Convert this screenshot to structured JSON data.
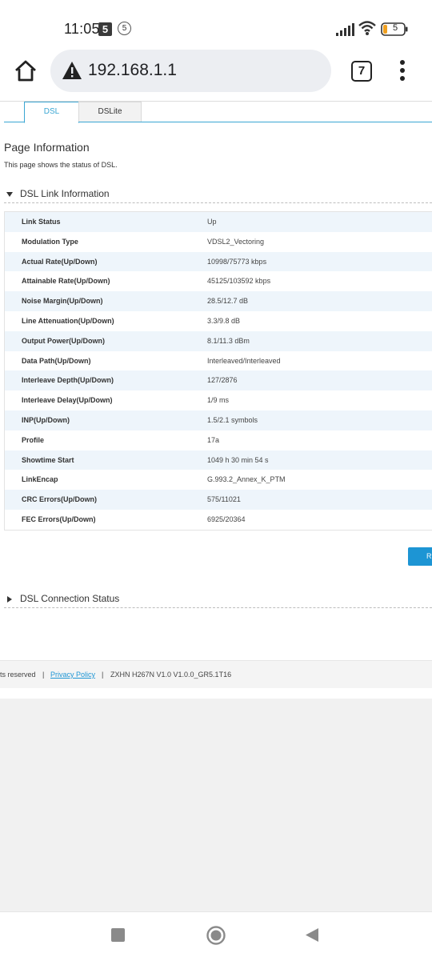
{
  "status_bar": {
    "time": "11:05",
    "notif_box": "5",
    "notif_circle": "5",
    "battery_level": "5",
    "icons": [
      "signal-icon",
      "wifi-icon",
      "battery-icon"
    ]
  },
  "browser": {
    "url": "192.168.1.1",
    "tab_count": "7",
    "icons": [
      "home-icon",
      "warning-icon",
      "tabs-icon",
      "more-vert-icon"
    ]
  },
  "tabs": [
    {
      "label": "DSL",
      "active": true
    },
    {
      "label": "DSLite",
      "active": false
    }
  ],
  "page": {
    "heading": "Page Information",
    "description": "This page shows the status of DSL."
  },
  "link_section": {
    "title": "DSL Link Information",
    "expanded": true,
    "rows": [
      {
        "label": "Link Status",
        "value": "Up"
      },
      {
        "label": "Modulation Type",
        "value": "VDSL2_Vectoring"
      },
      {
        "label": "Actual Rate(Up/Down)",
        "value": "10998/75773 kbps"
      },
      {
        "label": "Attainable Rate(Up/Down)",
        "value": "45125/103592 kbps"
      },
      {
        "label": "Noise Margin(Up/Down)",
        "value": "28.5/12.7 dB"
      },
      {
        "label": "Line Attenuation(Up/Down)",
        "value": "3.3/9.8 dB"
      },
      {
        "label": "Output Power(Up/Down)",
        "value": "8.1/11.3 dBm"
      },
      {
        "label": "Data Path(Up/Down)",
        "value": "Interleaved/Interleaved"
      },
      {
        "label": "Interleave Depth(Up/Down)",
        "value": "127/2876"
      },
      {
        "label": "Interleave Delay(Up/Down)",
        "value": "1/9 ms"
      },
      {
        "label": "INP(Up/Down)",
        "value": "1.5/2.1 symbols"
      },
      {
        "label": "Profile",
        "value": "17a"
      },
      {
        "label": "Showtime Start",
        "value": "1049 h 30 min 54 s"
      },
      {
        "label": "LinkEncap",
        "value": "G.993.2_Annex_K_PTM"
      },
      {
        "label": "CRC Errors(Up/Down)",
        "value": "575/11021"
      },
      {
        "label": "FEC Errors(Up/Down)",
        "value": "6925/20364"
      }
    ]
  },
  "refresh_button": {
    "label": "R"
  },
  "conn_section": {
    "title": "DSL Connection Status",
    "expanded": false
  },
  "footer": {
    "rights": "ts reserved",
    "separator": "|",
    "privacy_link": "Privacy Policy",
    "version": "ZXHN H267N V1.0 V1.0.0_GR5.1T16"
  },
  "nav_bar": {
    "icons": [
      "recent-apps-icon",
      "home-circle-icon",
      "back-icon"
    ]
  },
  "colors": {
    "accent": "#3aa6d3",
    "button": "#1d95d4",
    "row_alt": "#eef5fb"
  }
}
